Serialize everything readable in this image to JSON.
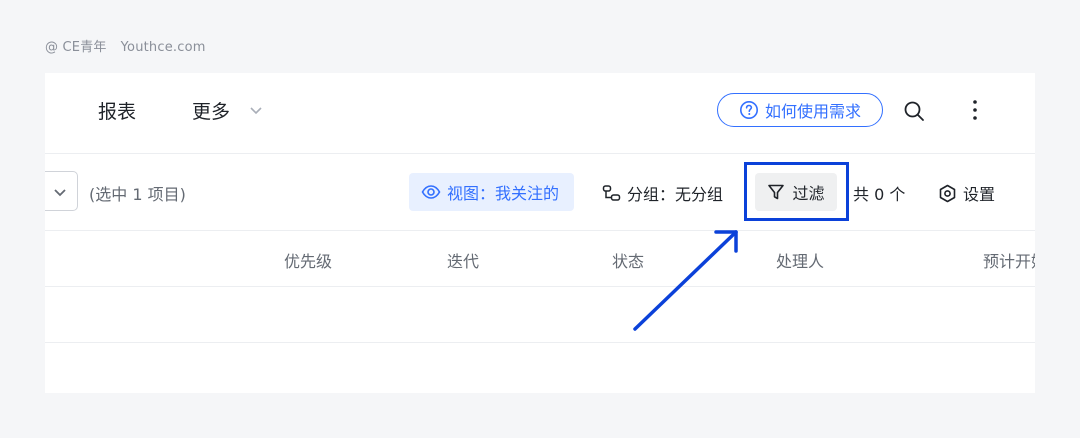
{
  "watermark": {
    "brand": "@ CE青年",
    "site": "Youthce.com"
  },
  "nav": {
    "tabs": [
      {
        "label": "报表"
      },
      {
        "label": "更多"
      }
    ],
    "help_label": "如何使用需求",
    "icons": {
      "more": "chevron-down-icon",
      "help": "question-circle-icon",
      "search": "search-icon",
      "menu": "kebab-icon"
    }
  },
  "toolbar": {
    "selected_count": "(选中 1 项目)",
    "view_label": "视图：我关注的",
    "group_label": "分组：无分组",
    "filter_label": "过滤",
    "total_count": "共 0 个",
    "settings_label": "设置",
    "icons": {
      "select": "chevron-down-icon",
      "view": "eye-icon",
      "group": "group-icon",
      "filter": "filter-icon",
      "settings": "hexagon-gear-icon"
    }
  },
  "table": {
    "columns": [
      "优先级",
      "迭代",
      "状态",
      "处理人",
      "预计开始"
    ]
  },
  "colors": {
    "accent": "#3370ff",
    "annotation": "#0b41d9",
    "chip_bg": "#e8f0ff"
  }
}
